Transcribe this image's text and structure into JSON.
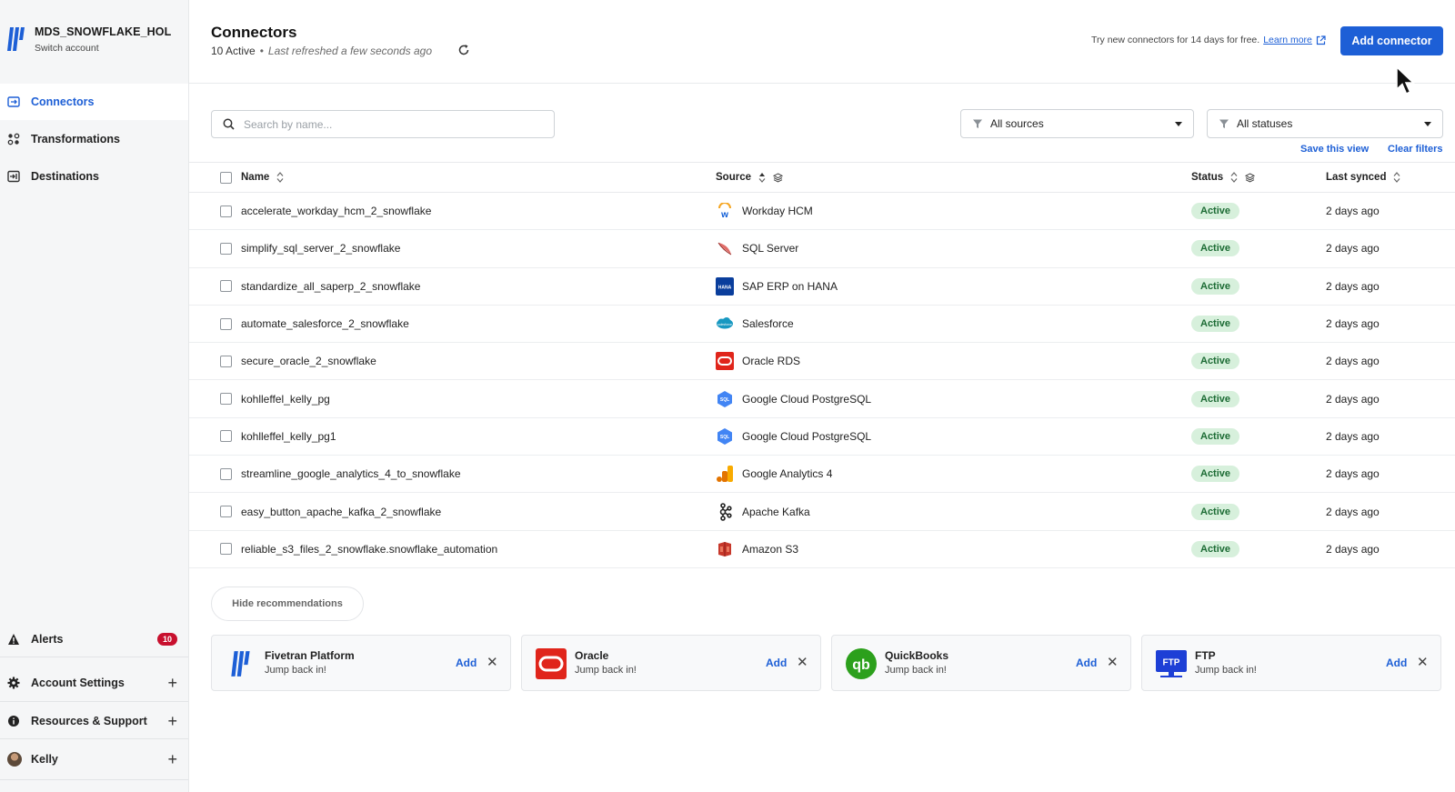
{
  "account": {
    "name": "MDS_SNOWFLAKE_HOL",
    "switch_label": "Switch account"
  },
  "nav": [
    {
      "label": "Connectors",
      "icon": "connectors-icon"
    },
    {
      "label": "Transformations",
      "icon": "transformations-icon"
    },
    {
      "label": "Destinations",
      "icon": "destinations-icon"
    }
  ],
  "bottom_nav": {
    "alerts": {
      "label": "Alerts",
      "count": "10"
    },
    "account_settings": "Account Settings",
    "resources": "Resources & Support",
    "user": "Kelly"
  },
  "header": {
    "title": "Connectors",
    "active_count": "10 Active",
    "separator": "•",
    "refreshed": "Last refreshed a few seconds ago",
    "trial_text": "Try new connectors for 14 days for free.",
    "learn_more": "Learn more",
    "add_button": "Add connector"
  },
  "filters": {
    "search_placeholder": "Search by name...",
    "sources": "All sources",
    "statuses": "All statuses",
    "save_view": "Save this view",
    "clear": "Clear filters"
  },
  "table": {
    "columns": {
      "name": "Name",
      "source": "Source",
      "status": "Status",
      "last_synced": "Last synced"
    },
    "rows": [
      {
        "name": "accelerate_workday_hcm_2_snowflake",
        "source": "Workday HCM",
        "source_icon": "workday-icon",
        "status": "Active",
        "last_synced": "2 days ago"
      },
      {
        "name": "simplify_sql_server_2_snowflake",
        "source": "SQL Server",
        "source_icon": "sql-server-icon",
        "status": "Active",
        "last_synced": "2 days ago"
      },
      {
        "name": "standardize_all_saperp_2_snowflake",
        "source": "SAP ERP on HANA",
        "source_icon": "sap-hana-icon",
        "status": "Active",
        "last_synced": "2 days ago"
      },
      {
        "name": "automate_salesforce_2_snowflake",
        "source": "Salesforce",
        "source_icon": "salesforce-icon",
        "status": "Active",
        "last_synced": "2 days ago"
      },
      {
        "name": "secure_oracle_2_snowflake",
        "source": "Oracle RDS",
        "source_icon": "oracle-icon",
        "status": "Active",
        "last_synced": "2 days ago"
      },
      {
        "name": "kohlleffel_kelly_pg",
        "source": "Google Cloud PostgreSQL",
        "source_icon": "google-cloud-sql-icon",
        "status": "Active",
        "last_synced": "2 days ago"
      },
      {
        "name": "kohlleffel_kelly_pg1",
        "source": "Google Cloud PostgreSQL",
        "source_icon": "google-cloud-sql-icon",
        "status": "Active",
        "last_synced": "2 days ago"
      },
      {
        "name": "streamline_google_analytics_4_to_snowflake",
        "source": "Google Analytics 4",
        "source_icon": "google-analytics-icon",
        "status": "Active",
        "last_synced": "2 days ago"
      },
      {
        "name": "easy_button_apache_kafka_2_snowflake",
        "source": "Apache Kafka",
        "source_icon": "kafka-icon",
        "status": "Active",
        "last_synced": "2 days ago"
      },
      {
        "name": "reliable_s3_files_2_snowflake.snowflake_automation",
        "source": "Amazon S3",
        "source_icon": "amazon-s3-icon",
        "status": "Active",
        "last_synced": "2 days ago"
      }
    ]
  },
  "recommendations": {
    "hide_label": "Hide recommendations",
    "items": [
      {
        "title": "Fivetran Platform",
        "subtitle": "Jump back in!",
        "add": "Add",
        "icon": "fivetran-icon"
      },
      {
        "title": "Oracle",
        "subtitle": "Jump back in!",
        "add": "Add",
        "icon": "oracle-icon"
      },
      {
        "title": "QuickBooks",
        "subtitle": "Jump back in!",
        "add": "Add",
        "icon": "quickbooks-icon"
      },
      {
        "title": "FTP",
        "subtitle": "Jump back in!",
        "add": "Add",
        "icon": "ftp-icon"
      }
    ]
  },
  "colors": {
    "accent": "#1d5fd6",
    "active_badge_bg": "#d7f0dc",
    "active_badge_text": "#1c6b34",
    "alert": "#c8102e"
  }
}
